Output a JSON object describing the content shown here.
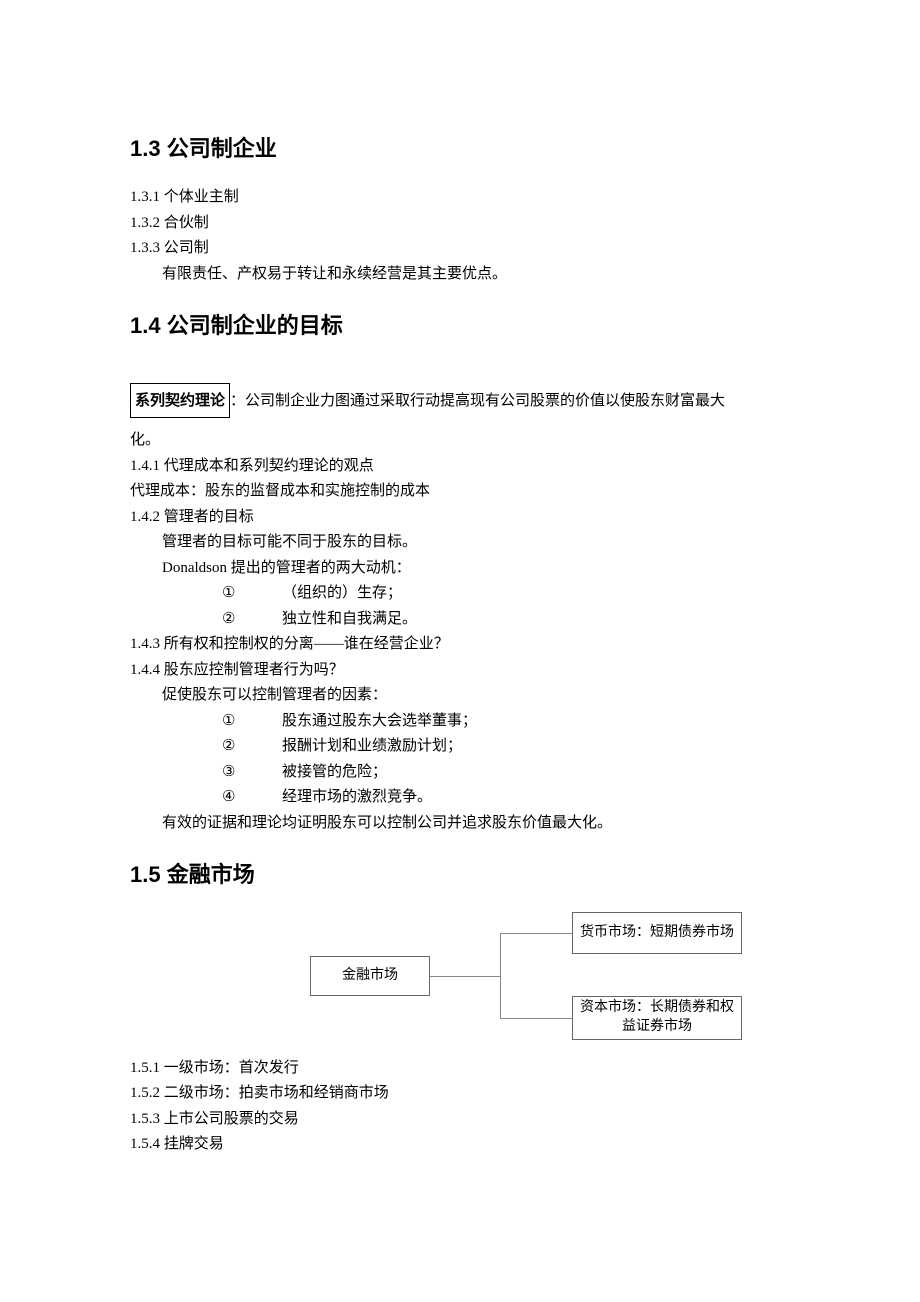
{
  "s13": {
    "heading": "1.3 公司制企业",
    "items": {
      "a": "1.3.1 个体业主制",
      "b": "1.3.2 合伙制",
      "c": "1.3.3 公司制",
      "c_note": "有限责任、产权易于转让和永续经营是其主要优点。"
    }
  },
  "s14": {
    "heading": "1.4 公司制企业的目标",
    "boxed": "系列契约理论",
    "boxed_tail": "：公司制企业力图通过采取行动提高现有公司股票的价值以使股东财富最大",
    "boxed_tail2": "化。",
    "i1": "1.4.1 代理成本和系列契约理论的观点",
    "i1a": "代理成本：股东的监督成本和实施控制的成本",
    "i2": "1.4.2 管理者的目标",
    "i2a": "管理者的目标可能不同于股东的目标。",
    "i2b": "Donaldson 提出的管理者的两大动机：",
    "i2b1n": "①",
    "i2b1t": "（组织的）生存；",
    "i2b2n": "②",
    "i2b2t": "独立性和自我满足。",
    "i3": "1.4.3 所有权和控制权的分离——谁在经营企业？",
    "i4": "1.4.4 股东应控制管理者行为吗？",
    "i4a": "促使股东可以控制管理者的因素：",
    "i4b1n": "①",
    "i4b1t": "股东通过股东大会选举董事；",
    "i4b2n": "②",
    "i4b2t": "报酬计划和业绩激励计划；",
    "i4b3n": "③",
    "i4b3t": "被接管的危险；",
    "i4b4n": "④",
    "i4b4t": "经理市场的激烈竞争。",
    "i4c": "有效的证据和理论均证明股东可以控制公司并追求股东价值最大化。"
  },
  "s15": {
    "heading": "1.5 金融市场",
    "diagram": {
      "root": "金融市场",
      "top": "货币市场：短期债券市场",
      "bot": "资本市场：长期债券和权益证券市场"
    },
    "i1": "1.5.1 一级市场：首次发行",
    "i2": "1.5.2 二级市场：拍卖市场和经销商市场",
    "i3": "1.5.3 上市公司股票的交易",
    "i4": "1.5.4 挂牌交易"
  }
}
